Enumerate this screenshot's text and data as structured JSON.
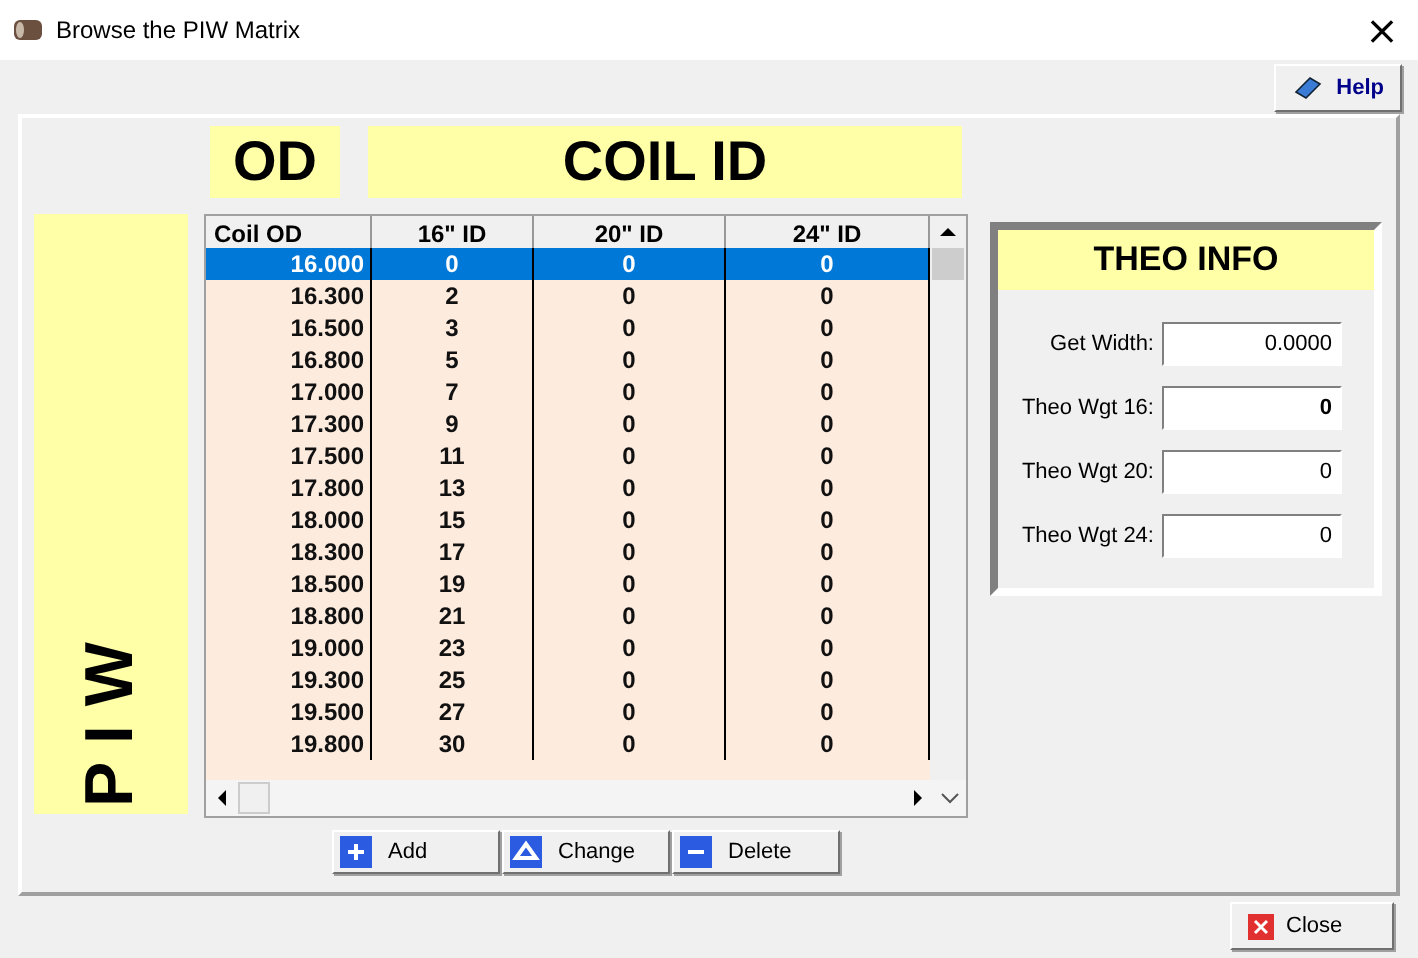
{
  "window": {
    "title": "Browse the PIW Matrix",
    "close": "×"
  },
  "help_button": "Help",
  "od_label": "OD",
  "coil_id_label": "COIL ID",
  "piw_label": "P I W",
  "table": {
    "columns": [
      "Coil OD",
      "16\" ID",
      "20\" ID",
      "24\" ID"
    ],
    "rows": [
      {
        "cells": [
          "16.000",
          "0",
          "0",
          "0"
        ],
        "selected": true
      },
      {
        "cells": [
          "16.300",
          "2",
          "0",
          "0"
        ],
        "selected": false
      },
      {
        "cells": [
          "16.500",
          "3",
          "0",
          "0"
        ],
        "selected": false
      },
      {
        "cells": [
          "16.800",
          "5",
          "0",
          "0"
        ],
        "selected": false
      },
      {
        "cells": [
          "17.000",
          "7",
          "0",
          "0"
        ],
        "selected": false
      },
      {
        "cells": [
          "17.300",
          "9",
          "0",
          "0"
        ],
        "selected": false
      },
      {
        "cells": [
          "17.500",
          "11",
          "0",
          "0"
        ],
        "selected": false
      },
      {
        "cells": [
          "17.800",
          "13",
          "0",
          "0"
        ],
        "selected": false
      },
      {
        "cells": [
          "18.000",
          "15",
          "0",
          "0"
        ],
        "selected": false
      },
      {
        "cells": [
          "18.300",
          "17",
          "0",
          "0"
        ],
        "selected": false
      },
      {
        "cells": [
          "18.500",
          "19",
          "0",
          "0"
        ],
        "selected": false
      },
      {
        "cells": [
          "18.800",
          "21",
          "0",
          "0"
        ],
        "selected": false
      },
      {
        "cells": [
          "19.000",
          "23",
          "0",
          "0"
        ],
        "selected": false
      },
      {
        "cells": [
          "19.300",
          "25",
          "0",
          "0"
        ],
        "selected": false
      },
      {
        "cells": [
          "19.500",
          "27",
          "0",
          "0"
        ],
        "selected": false
      },
      {
        "cells": [
          "19.800",
          "30",
          "0",
          "0"
        ],
        "selected": false
      }
    ]
  },
  "actions": [
    {
      "label": "Add",
      "kind": "add"
    },
    {
      "label": "Change",
      "kind": "change"
    },
    {
      "label": "Delete",
      "kind": "delete"
    }
  ],
  "theo_info": {
    "title": "THEO INFO",
    "fields": [
      {
        "label": "Get Width:",
        "value": "0.0000",
        "bold": false
      },
      {
        "label": "Theo Wgt 16:",
        "value": "0",
        "bold": true
      },
      {
        "label": "Theo Wgt 20:",
        "value": "0",
        "bold": false
      },
      {
        "label": "Theo Wgt 24:",
        "value": "0",
        "bold": false
      }
    ]
  },
  "close_button": "Close"
}
